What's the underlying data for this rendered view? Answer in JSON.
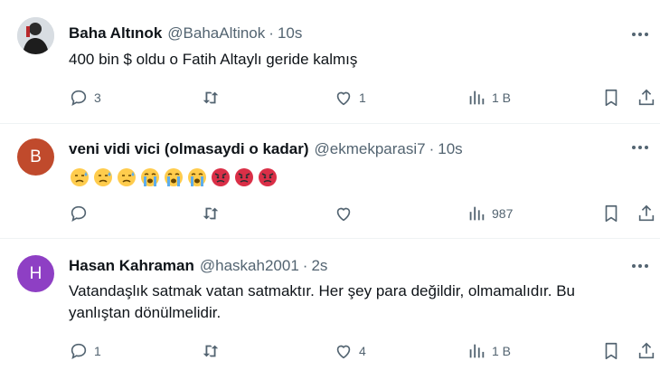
{
  "tweets": [
    {
      "name": "Baha Altınok",
      "handle": "@BahaAltinok",
      "time": "10s",
      "text": "400 bin $ oldu o Fatih Altaylı geride kalmış",
      "avatar_letter": "",
      "stats": {
        "replies": "3",
        "retweets": "",
        "likes": "1",
        "views": "1 B"
      }
    },
    {
      "name": "veni vidi vici (olmasaydi o kadar)",
      "handle": "@ekmekparasi7",
      "time": "10s",
      "text": "",
      "avatar_letter": "B",
      "emojis": [
        "downcast-sweat-face",
        "downcast-sweat-face",
        "downcast-sweat-face",
        "crying-face",
        "crying-face",
        "crying-face",
        "angry-face",
        "angry-face",
        "angry-face"
      ],
      "stats": {
        "replies": "",
        "retweets": "",
        "likes": "",
        "views": "987"
      }
    },
    {
      "name": "Hasan Kahraman",
      "handle": "@haskah2001",
      "time": "2s",
      "text_line1": "Vatandaşlık satmak vatan satmaktır. Her şey para değildir, olmamalıdır. Bu",
      "text_line2": "yanlıştan dönülmelidir.",
      "avatar_letter": "H",
      "stats": {
        "replies": "1",
        "retweets": "",
        "likes": "4",
        "views": "1 B"
      }
    }
  ],
  "separator": "·",
  "colors": {
    "text": "#0f1419",
    "muted": "#536471",
    "divider": "#eff3f4",
    "avatar_b": "#c04a2c",
    "avatar_h": "#8e3fc4"
  }
}
